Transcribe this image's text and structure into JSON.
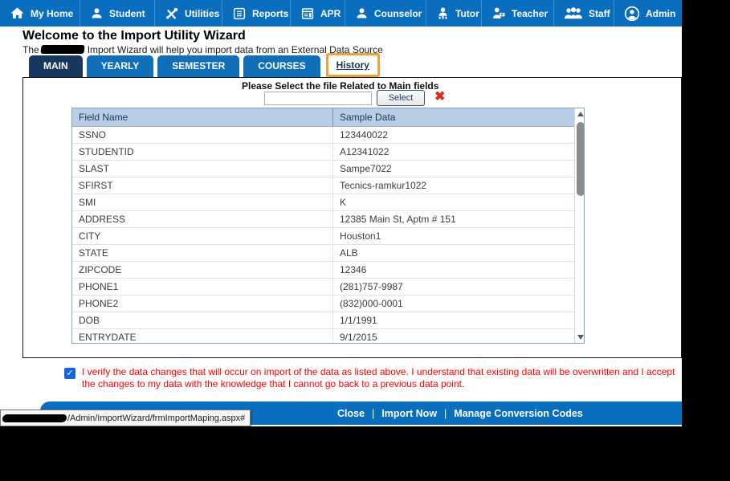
{
  "colors": {
    "nav_blue": "#0A6EBE",
    "tab_active_navy": "#17375E",
    "tab_blue": "#0F6FB8",
    "highlight_orange": "#E8A33C",
    "table_header_bg": "#B9CDE5",
    "verify_text_red": "#FF0000",
    "checkbox_blue": "#1465DB",
    "clear_icon_red": "#D62E1F"
  },
  "nav": {
    "items": [
      {
        "label": "My Home",
        "icon": "home-icon"
      },
      {
        "label": "Student",
        "icon": "student-icon"
      },
      {
        "label": "Utilities",
        "icon": "utilities-icon"
      },
      {
        "label": "Reports",
        "icon": "reports-icon"
      },
      {
        "label": "APR",
        "icon": "apr-icon"
      },
      {
        "label": "Counselor",
        "icon": "counselor-icon"
      },
      {
        "label": "Tutor",
        "icon": "tutor-icon"
      },
      {
        "label": "Teacher",
        "icon": "teacher-icon"
      },
      {
        "label": "Staff",
        "icon": "staff-icon"
      },
      {
        "label": "Admin",
        "icon": "admin-icon"
      }
    ]
  },
  "header": {
    "title": "Welcome to the Import Utility Wizard",
    "subtitle_prefix": "The",
    "subtitle_suffix": "Import Wizard will help you import data from an External Data Source"
  },
  "tabs": [
    {
      "label": "MAIN",
      "active": true
    },
    {
      "label": "YEARLY",
      "active": false
    },
    {
      "label": "SEMESTER",
      "active": false
    },
    {
      "label": "COURSES",
      "active": false
    },
    {
      "label": "History",
      "active": false,
      "highlighted": true
    }
  ],
  "file_select": {
    "label": "Please Select the file Related to Main fields",
    "input_value": "",
    "button_label": "Select",
    "clear_icon": "✖"
  },
  "table": {
    "columns": [
      "Field Name",
      "Sample Data"
    ],
    "rows": [
      {
        "field": "SSNO",
        "sample": "123440022"
      },
      {
        "field": "STUDENTID",
        "sample": "A12341022"
      },
      {
        "field": "SLAST",
        "sample": "Sampe7022"
      },
      {
        "field": "SFIRST",
        "sample": "Tecnics-ramkur1022"
      },
      {
        "field": "SMI",
        "sample": "K"
      },
      {
        "field": "ADDRESS",
        "sample": "12385 Main St, Aptm # 151"
      },
      {
        "field": "CITY",
        "sample": "Houston1"
      },
      {
        "field": "STATE",
        "sample": "ALB"
      },
      {
        "field": "ZIPCODE",
        "sample": "12346"
      },
      {
        "field": "PHONE1",
        "sample": "(281)757-9987"
      },
      {
        "field": "PHONE2",
        "sample": "(832)000-0001"
      },
      {
        "field": "DOB",
        "sample": "1/1/1991"
      },
      {
        "field": "ENTRYDATE",
        "sample": "9/1/2015"
      }
    ]
  },
  "verify": {
    "checked": true,
    "checkmark": "✓",
    "text": "I verify the data changes that will occur on import of the data as listed above. I understand that existing data will be overwritten and I accept the changes to my data with the knowledge that I cannot go back to a previous data point."
  },
  "footer": {
    "links": [
      "Close",
      "Import Now",
      "Manage Conversion Codes"
    ],
    "separator": "|"
  },
  "statusbar": {
    "url": "/Admin/ImportWizard/frmImportMaping.aspx#"
  }
}
